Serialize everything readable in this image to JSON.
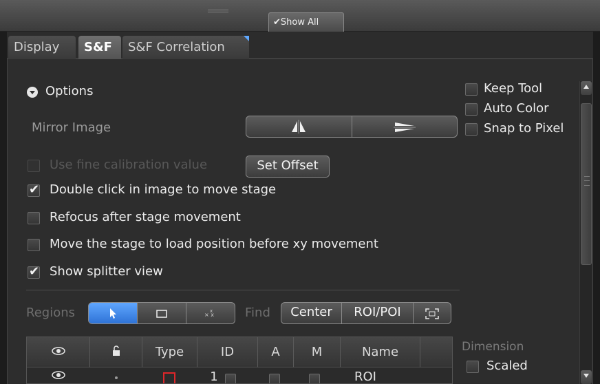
{
  "header": {
    "show_all_label": "✔Show All"
  },
  "tabs": [
    {
      "label": "Display",
      "active": false
    },
    {
      "label": "S&F",
      "active": true
    },
    {
      "label": "S&F Correlation",
      "active": false
    }
  ],
  "options": {
    "section_label": "Options",
    "mirror_label": "Mirror Image",
    "keep_tool": {
      "label": "Keep Tool",
      "checked": false
    },
    "auto_color": {
      "label": "Auto Color",
      "checked": false
    },
    "snap_to_pixel": {
      "label": "Snap to Pixel",
      "checked": false
    },
    "fine_calibration": {
      "label": "Use fine calibration value",
      "checked": false,
      "enabled": false
    },
    "set_offset_label": "Set Offset",
    "double_click": {
      "label": "Double click in image to move stage",
      "checked": true
    },
    "refocus": {
      "label": "Refocus after stage movement",
      "checked": false
    },
    "load_position": {
      "label": "Move the stage to load position before xy movement",
      "checked": false
    },
    "splitter": {
      "label": "Show splitter view",
      "checked": true
    }
  },
  "regions": {
    "label": "Regions",
    "tools": [
      "pointer-icon",
      "rectangle-icon",
      "scatter-points-icon"
    ],
    "find_label": "Find",
    "center_label": "Center",
    "roi_poi_label": "ROI/POI",
    "fit_icon": "fit-frame-icon"
  },
  "table": {
    "columns": [
      "eye-icon",
      "lock-icon",
      "Type",
      "ID",
      "A",
      "M",
      "Name"
    ],
    "rows": [
      {
        "id": "1",
        "name": "ROI"
      }
    ]
  },
  "dimension": {
    "label": "Dimension",
    "scaled": {
      "label": "Scaled",
      "checked": false
    }
  },
  "colors": {
    "accent": "#3d8bf0",
    "type_red": "#e0262a"
  }
}
